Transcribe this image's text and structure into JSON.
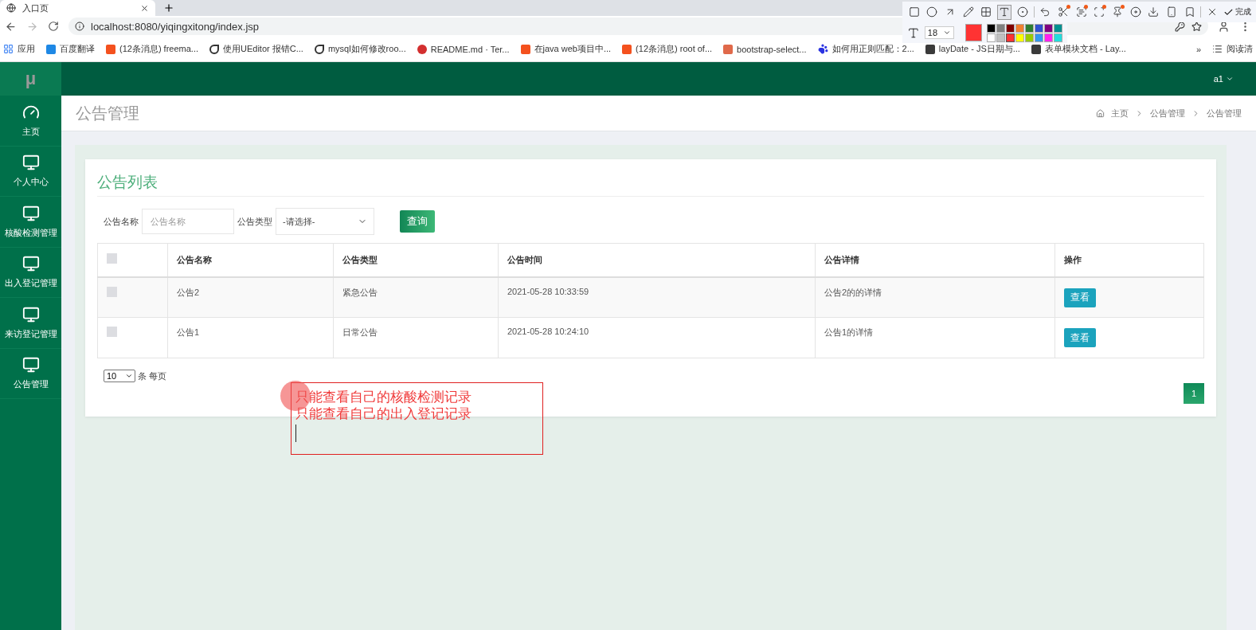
{
  "browser": {
    "tab_title": "入口页",
    "url": "localhost:8080/yiqingxitong/index.jsp",
    "bookmarks": [
      {
        "label": "应用",
        "kind": "grid",
        "color": "#4285f4"
      },
      {
        "label": "百度翻译",
        "kind": "square",
        "color": "#1e88e5"
      },
      {
        "label": "(12条消息) freema...",
        "kind": "square",
        "color": "#f4511e"
      },
      {
        "label": "使用UEditor 报错C...",
        "kind": "glyph",
        "color": "#333333"
      },
      {
        "label": "mysql如何修改roo...",
        "kind": "glyph",
        "color": "#333333"
      },
      {
        "label": "README.md · Ter...",
        "kind": "round",
        "color": "#d32f2f"
      },
      {
        "label": "在java web项目中...",
        "kind": "square",
        "color": "#f4511e"
      },
      {
        "label": "(12条消息) root of...",
        "kind": "square",
        "color": "#f4511e"
      },
      {
        "label": "bootstrap-select...",
        "kind": "square",
        "color": "#e0694a"
      },
      {
        "label": "如何用正则匹配：2...",
        "kind": "paw",
        "color": "#2932e1"
      },
      {
        "label": "layDate - JS日期与...",
        "kind": "square",
        "color": "#3a3a3a"
      },
      {
        "label": "表单模块文档 - Lay...",
        "kind": "square",
        "color": "#3a3a3a"
      }
    ],
    "more": "»",
    "reading_list": "阅读清"
  },
  "capture_toolbar": {
    "tools": [
      {
        "kind": "rect",
        "selected": false,
        "dot": false
      },
      {
        "kind": "ellipse",
        "selected": false,
        "dot": false
      },
      {
        "kind": "arrow",
        "selected": false,
        "dot": false
      },
      {
        "kind": "pencil",
        "selected": false,
        "dot": false
      },
      {
        "kind": "mosaic",
        "selected": false,
        "dot": false
      },
      {
        "kind": "text",
        "selected": true,
        "dot": false
      },
      {
        "kind": "number",
        "selected": false,
        "dot": false
      },
      {
        "kind": "sep"
      },
      {
        "kind": "undo",
        "selected": false,
        "dot": false
      },
      {
        "kind": "scissors",
        "selected": false,
        "dot": true
      },
      {
        "kind": "ocr",
        "selected": false,
        "dot": true
      },
      {
        "kind": "scan",
        "selected": false,
        "dot": true
      },
      {
        "kind": "pin",
        "selected": false,
        "dot": true
      },
      {
        "kind": "record",
        "selected": false,
        "dot": false
      },
      {
        "kind": "download",
        "selected": false,
        "dot": false
      },
      {
        "kind": "phone",
        "selected": false,
        "dot": false
      },
      {
        "kind": "bookmark",
        "selected": false,
        "dot": false
      },
      {
        "kind": "sep"
      },
      {
        "kind": "close",
        "selected": false,
        "dot": false
      }
    ],
    "done": "完成",
    "font_size": "18",
    "swatches": [
      {
        "color": "#000000",
        "selected": false
      },
      {
        "color": "#808080",
        "selected": false
      },
      {
        "color": "#800000",
        "selected": false
      },
      {
        "color": "#f08030",
        "selected": false
      },
      {
        "color": "#2e7d32",
        "selected": false
      },
      {
        "color": "#3050d0",
        "selected": false
      },
      {
        "color": "#800080",
        "selected": false
      },
      {
        "color": "#009090",
        "selected": false
      },
      {
        "color": "#ffffff",
        "selected": false
      },
      {
        "color": "#c0c0c0",
        "selected": false
      },
      {
        "color": "#ff3333",
        "selected": true
      },
      {
        "color": "#ffff00",
        "selected": false
      },
      {
        "color": "#99cc00",
        "selected": false
      },
      {
        "color": "#3399ee",
        "selected": false
      },
      {
        "color": "#ff22ee",
        "selected": false
      },
      {
        "color": "#22dddd",
        "selected": false
      }
    ]
  },
  "app": {
    "logo": "μ",
    "user": "a1",
    "sidebar": [
      {
        "label": "主页",
        "kind": "dashboard"
      },
      {
        "label": "个人中心",
        "kind": "monitor"
      },
      {
        "label": "核酸检测管理",
        "kind": "monitor"
      },
      {
        "label": "出入登记管理",
        "kind": "monitor"
      },
      {
        "label": "来访登记管理",
        "kind": "monitor"
      },
      {
        "label": "公告管理",
        "kind": "monitor"
      }
    ],
    "page_title": "公告管理",
    "breadcrumbs": [
      "主页",
      "公告管理",
      "公告管理"
    ],
    "card_title": "公告列表",
    "filters": {
      "name_label": "公告名称",
      "name_placeholder": "公告名称",
      "type_label": "公告类型",
      "type_value": "-请选择-",
      "search_button": "查询"
    },
    "table": {
      "all_checked": false,
      "columns": [
        "公告名称",
        "公告类型",
        "公告时间",
        "公告详情",
        "操作"
      ],
      "rows": [
        {
          "checked": false,
          "cells": [
            "公告2",
            "紧急公告",
            "2021-05-28 10:33:59",
            "公告2的的详情"
          ],
          "action": "查看"
        },
        {
          "checked": false,
          "cells": [
            "公告1",
            "日常公告",
            "2021-05-28 10:24:10",
            "公告1的详情"
          ],
          "action": "查看"
        }
      ]
    },
    "page_size": "10",
    "page_size_label": "条 每页",
    "pages": [
      {
        "label": "1",
        "selected": true
      }
    ]
  },
  "annotation": {
    "lines": [
      "只能查看自己的核酸检测记录",
      "只能查看自己的出入登记记录"
    ]
  }
}
